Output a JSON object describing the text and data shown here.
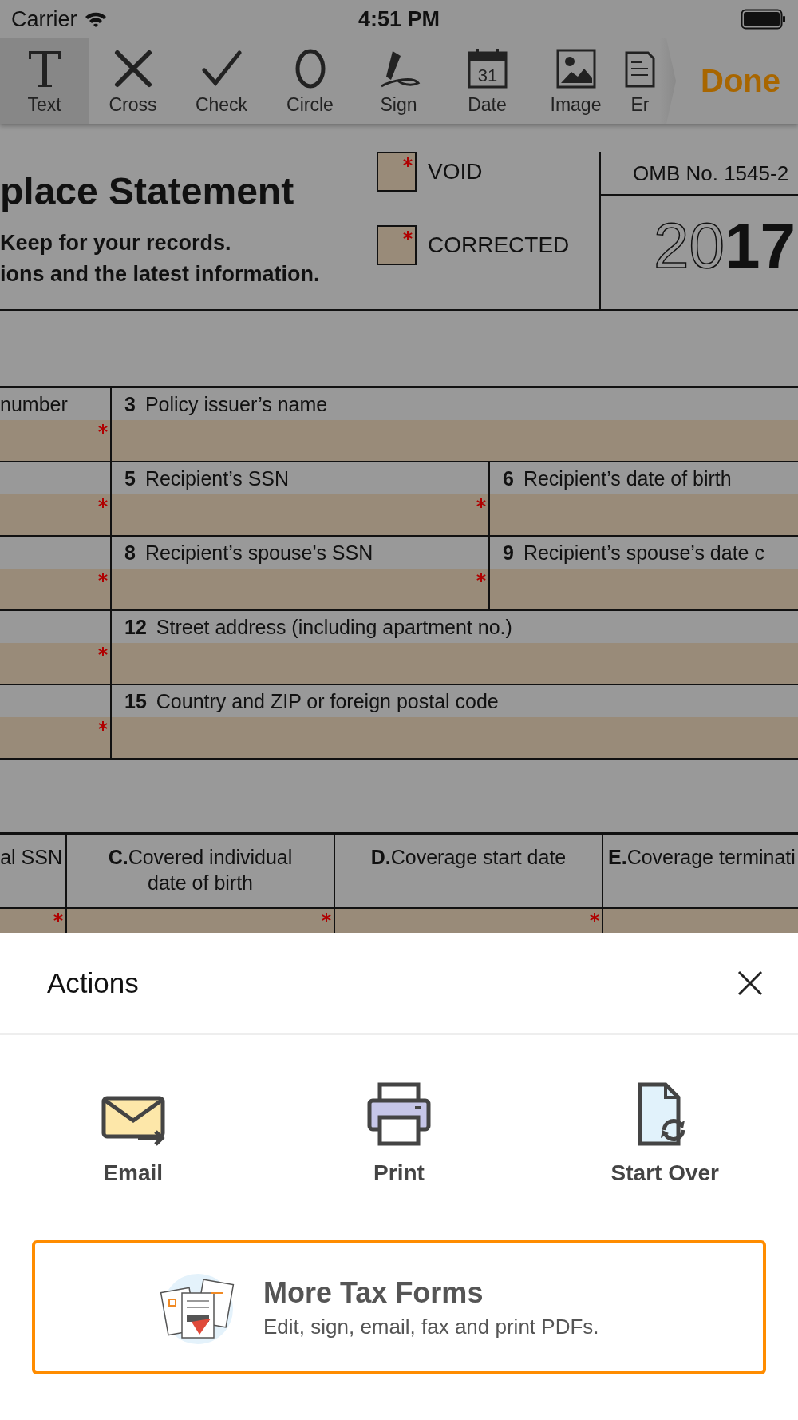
{
  "status_bar": {
    "carrier": "Carrier",
    "time": "4:51 PM"
  },
  "toolbar": {
    "tools": [
      {
        "kind": "text",
        "label": "Text",
        "selected": true
      },
      {
        "kind": "cross",
        "label": "Cross",
        "selected": false
      },
      {
        "kind": "check",
        "label": "Check",
        "selected": false
      },
      {
        "kind": "circle",
        "label": "Circle",
        "selected": false
      },
      {
        "kind": "sign",
        "label": "Sign",
        "selected": false
      },
      {
        "kind": "date",
        "label": "Date",
        "icon_text": "31",
        "selected": false
      },
      {
        "kind": "image",
        "label": "Image",
        "selected": false
      },
      {
        "kind": "doc",
        "label": "Er",
        "selected": false
      }
    ],
    "done": "Done"
  },
  "form": {
    "title": "place Statement",
    "notes": [
      "Keep for your records.",
      "ions and the latest information."
    ],
    "checkboxes": [
      {
        "label": "VOID",
        "checked": false,
        "required": true
      },
      {
        "label": "CORRECTED",
        "checked": false,
        "required": true
      }
    ],
    "omb": "OMB No. 1545-2",
    "year_outline": "20",
    "year_bold": "17",
    "rows": [
      {
        "cells": [
          {
            "label": "number",
            "required": true
          },
          {
            "number": "3",
            "label": "Policy issuer’s name",
            "required": false
          }
        ]
      },
      {
        "cells": [
          {
            "required": true
          },
          {
            "number": "5",
            "label": "Recipient’s SSN",
            "required": true
          },
          {
            "number": "6",
            "label": "Recipient’s date of birth",
            "required": false
          }
        ]
      },
      {
        "cells": [
          {
            "required": true
          },
          {
            "number": "8",
            "label": "Recipient’s spouse’s SSN",
            "required": true
          },
          {
            "number": "9",
            "label": "Recipient’s spouse’s date c",
            "required": false
          }
        ]
      },
      {
        "cells": [
          {
            "required": true
          },
          {
            "number": "12",
            "label": "Street address (including apartment no.)",
            "required": false
          }
        ]
      },
      {
        "cells": [
          {
            "required": true
          },
          {
            "number": "15",
            "label": "Country and ZIP or foreign postal code",
            "required": false
          }
        ]
      }
    ],
    "table_columns": [
      {
        "label": "al SSN",
        "required": true
      },
      {
        "letter": "C.",
        "label": "Covered individual date of birth",
        "required": true
      },
      {
        "letter": "D.",
        "label": "Coverage start date",
        "required": true
      },
      {
        "letter": "E.",
        "label": "Coverage terminati",
        "required": false
      }
    ]
  },
  "sheet": {
    "title": "Actions",
    "actions": [
      {
        "kind": "email",
        "label": "Email"
      },
      {
        "kind": "print",
        "label": "Print"
      },
      {
        "kind": "start_over",
        "label": "Start Over"
      }
    ],
    "promo": {
      "title": "More Tax Forms",
      "subtitle": "Edit, sign, email, fax and print PDFs."
    }
  }
}
